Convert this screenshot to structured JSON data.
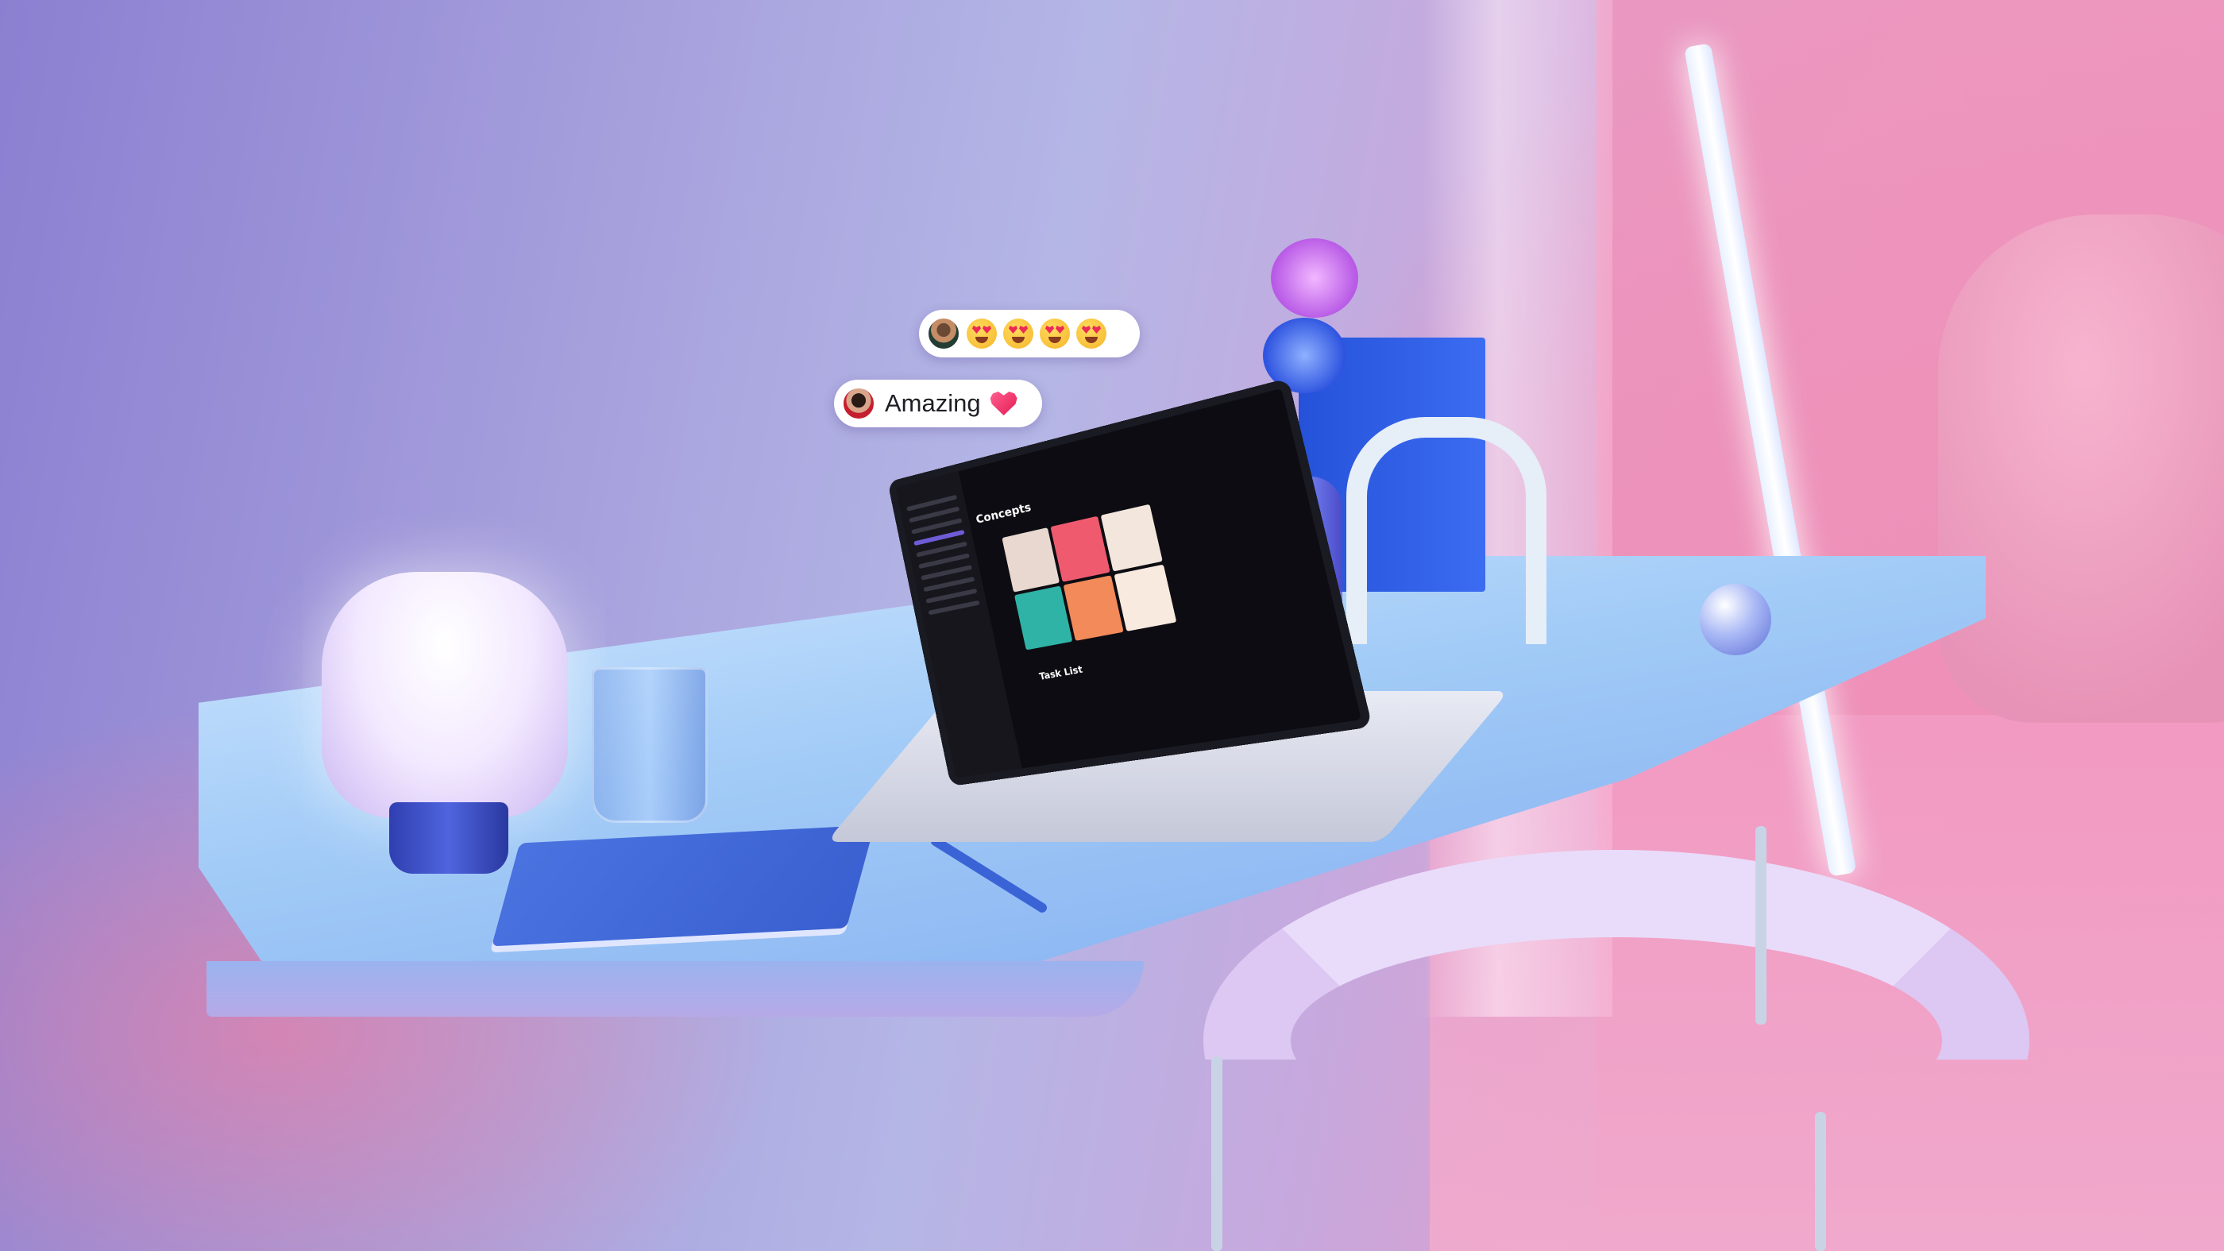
{
  "reactions": {
    "emoji_bubble": {
      "avatar": "avatar-photo",
      "emojis": [
        "heart-eyes-emoji",
        "heart-eyes-emoji",
        "heart-eyes-emoji",
        "heart-eyes-emoji"
      ]
    },
    "comment_bubble": {
      "avatar": "avatar-photo",
      "text": "Amazing",
      "icon": "sparkling-heart-icon"
    }
  },
  "laptop_screen": {
    "heading": "Concepts",
    "subheading": "Task List"
  },
  "colors": {
    "wall": "#b4b6e6",
    "pink_wall": "#ea8db8",
    "desk": "#a3ccf7",
    "book": "#2552d9"
  }
}
